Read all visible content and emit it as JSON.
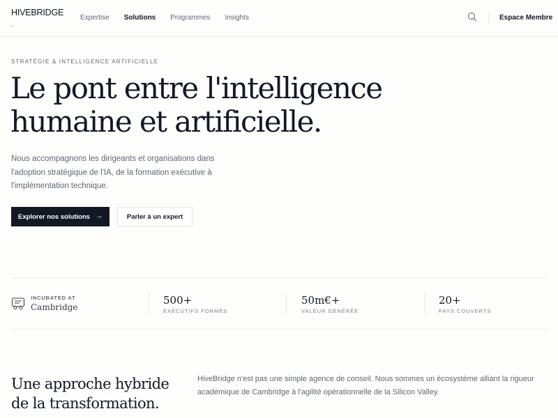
{
  "nav": {
    "logo": "HIVEBRIDGE",
    "logo_dot": ".",
    "links": [
      "Expertise",
      "Solutions",
      "Programmes",
      "Insights"
    ],
    "active_link": "Solutions",
    "search_icon": "search-icon",
    "member_label": "Espace Membre"
  },
  "hero": {
    "eyebrow": "STRATÉGIE & INTELLIGENCE ARTIFICIELLE",
    "headline_line1": "Le pont entre l'intelligence",
    "headline_line2": "humaine et artificielle.",
    "lede": "Nous accompagnons les dirigeants et organisations dans l'adoption stratégique de l'IA, de la formation exécutive à l'implémentation technique.",
    "primary_cta": "Explorer nos solutions",
    "primary_cta_icon": "arrow-right-icon",
    "secondary_cta": "Parler à un expert"
  },
  "stats": {
    "badge_icon": "certificate-icon",
    "incubated_label": "INCUBATED AT",
    "incubated_value": "Cambridge",
    "items": [
      {
        "value": "500+",
        "label": "EXÉCUTIFS FORMÉS"
      },
      {
        "value": "50m€+",
        "label": "VALEUR GÉNÉRÉE"
      },
      {
        "value": "20+",
        "label": "PAYS COUVERTS"
      }
    ]
  },
  "approach": {
    "title_line1": "Une approche hybride",
    "title_line2": "de la transformation.",
    "text": "HiveBridge n'est pas une simple agence de conseil. Nous sommes un écosystème alliant la rigueur académique de Cambridge à l'agilité opérationnelle de la Silicon Valley."
  },
  "colors": {
    "navy": "#121826",
    "muted_text": "#5f6674",
    "border": "#ececec",
    "background": "#fdfdfc"
  }
}
